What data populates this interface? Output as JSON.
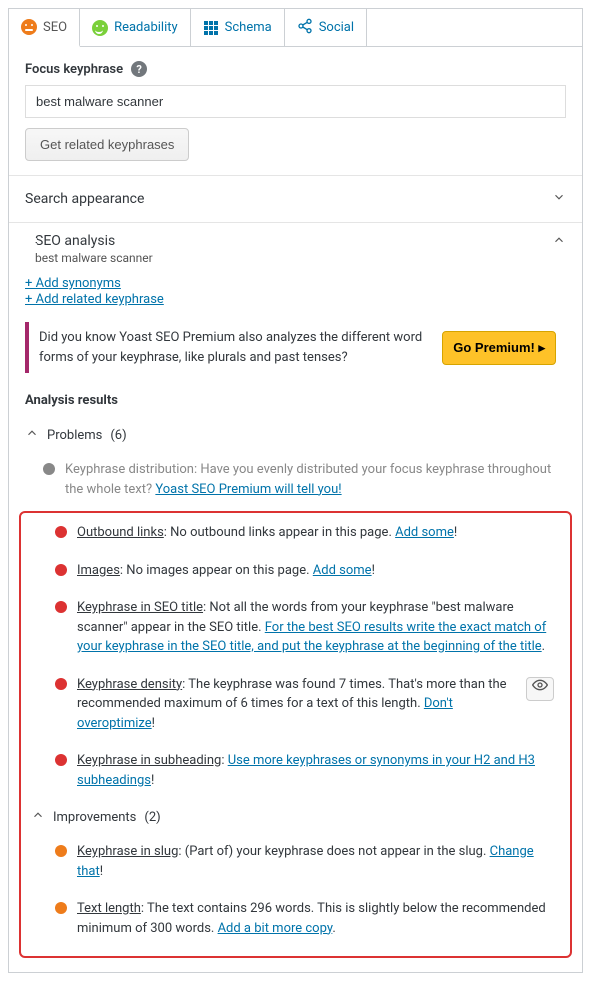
{
  "tabs": {
    "seo": "SEO",
    "readability": "Readability",
    "schema": "Schema",
    "social": "Social"
  },
  "focus": {
    "label": "Focus keyphrase",
    "value": "best malware scanner",
    "button": "Get related keyphrases"
  },
  "accordion": {
    "search_appearance": "Search appearance"
  },
  "analysis": {
    "title": "SEO analysis",
    "subtitle": "best malware scanner",
    "add_synonyms": "+ Add synonyms",
    "add_related": "+ Add related keyphrase"
  },
  "promo": {
    "text": "Did you know Yoast SEO Premium also analyzes the different word forms of your keyphrase, like plurals and past tenses?",
    "cta": "Go Premium!  ▸"
  },
  "results_header": "Analysis results",
  "groups": {
    "problems": {
      "label": "Problems",
      "count": "(6)"
    },
    "improvements": {
      "label": "Improvements",
      "count": "(2)"
    }
  },
  "items": {
    "dist": {
      "name": "Keyphrase distribution",
      "text": ": Have you evenly distributed your focus keyphrase throughout the whole text? ",
      "action": "Yoast SEO Premium will tell you!"
    },
    "outbound": {
      "name": "Outbound links",
      "text": ": No outbound links appear in this page. ",
      "action": "Add some",
      "tail": "!"
    },
    "images": {
      "name": "Images",
      "text": ": No images appear on this page. ",
      "action": "Add some",
      "tail": "!"
    },
    "seotitle": {
      "name": "Keyphrase in SEO title",
      "text": ": Not all the words from your keyphrase \"best malware scanner\" appear in the SEO title. ",
      "action": "For the best SEO results write the exact match of your keyphrase in the SEO title, and put the keyphrase at the beginning of the title",
      "tail": "."
    },
    "density": {
      "name": "Keyphrase density",
      "text": ": The keyphrase was found 7 times. That's more than the recommended maximum of 6 times for a text of this length. ",
      "action": "Don't overoptimize",
      "tail": "!"
    },
    "subheading": {
      "name": "Keyphrase in subheading",
      "text": ": ",
      "action": "Use more keyphrases or synonyms in your H2 and H3 subheadings",
      "tail": "!"
    },
    "slug": {
      "name": "Keyphrase in slug",
      "text": ": (Part of) your keyphrase does not appear in the slug. ",
      "action": "Change that",
      "tail": "!"
    },
    "textlen": {
      "name": "Text length",
      "text": ": The text contains 296 words. This is slightly below the recommended minimum of 300 words. ",
      "action": "Add a bit more copy",
      "tail": "."
    }
  }
}
